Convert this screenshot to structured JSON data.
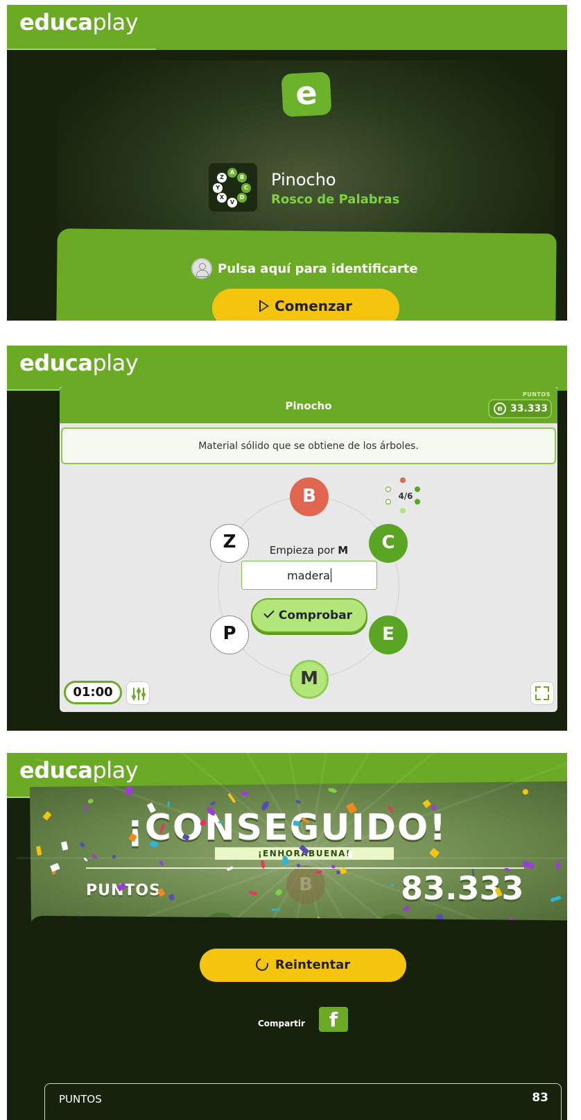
{
  "brand": {
    "logo_bold": "educa",
    "logo_light": "play"
  },
  "intro": {
    "game_title": "Pinocho",
    "game_type": "Rosco de Palabras",
    "login_label": "Pulsa aquí para identificarte",
    "start_label": "Comenzar",
    "icon_letters": [
      "Z",
      "A",
      "B",
      "C",
      "D",
      "V",
      "X",
      "Y"
    ]
  },
  "game": {
    "title": "Pinocho",
    "points_label": "PUNTOS",
    "points_value": "33.333",
    "clue": "Material sólido que se obtiene de los árboles.",
    "prompt_prefix": "Empieza por",
    "prompt_letter": "M",
    "answer": "madera",
    "check_label": "Comprobar",
    "progress": "4/6",
    "timer": "01:00",
    "letters": [
      {
        "letter": "B",
        "state": "wrong"
      },
      {
        "letter": "C",
        "state": "correct"
      },
      {
        "letter": "E",
        "state": "correct"
      },
      {
        "letter": "M",
        "state": "current"
      },
      {
        "letter": "P",
        "state": "pending"
      },
      {
        "letter": "Z",
        "state": "pending"
      }
    ],
    "colors": {
      "accent": "#6aaa24",
      "wrong": "#e06650",
      "correct": "#5aa523",
      "current": "#b2e67a"
    }
  },
  "result": {
    "headline": "¡CONSEGUIDO!",
    "subheadline": "¡ENHORABUENA!",
    "points_label": "PUNTOS",
    "points_value": "83.333",
    "bg_letter": "B",
    "retry_label": "Reintentar",
    "share_label": "Compartir",
    "share_icon": "facebook-icon",
    "summary_label": "PUNTOS",
    "summary_value": "83"
  }
}
